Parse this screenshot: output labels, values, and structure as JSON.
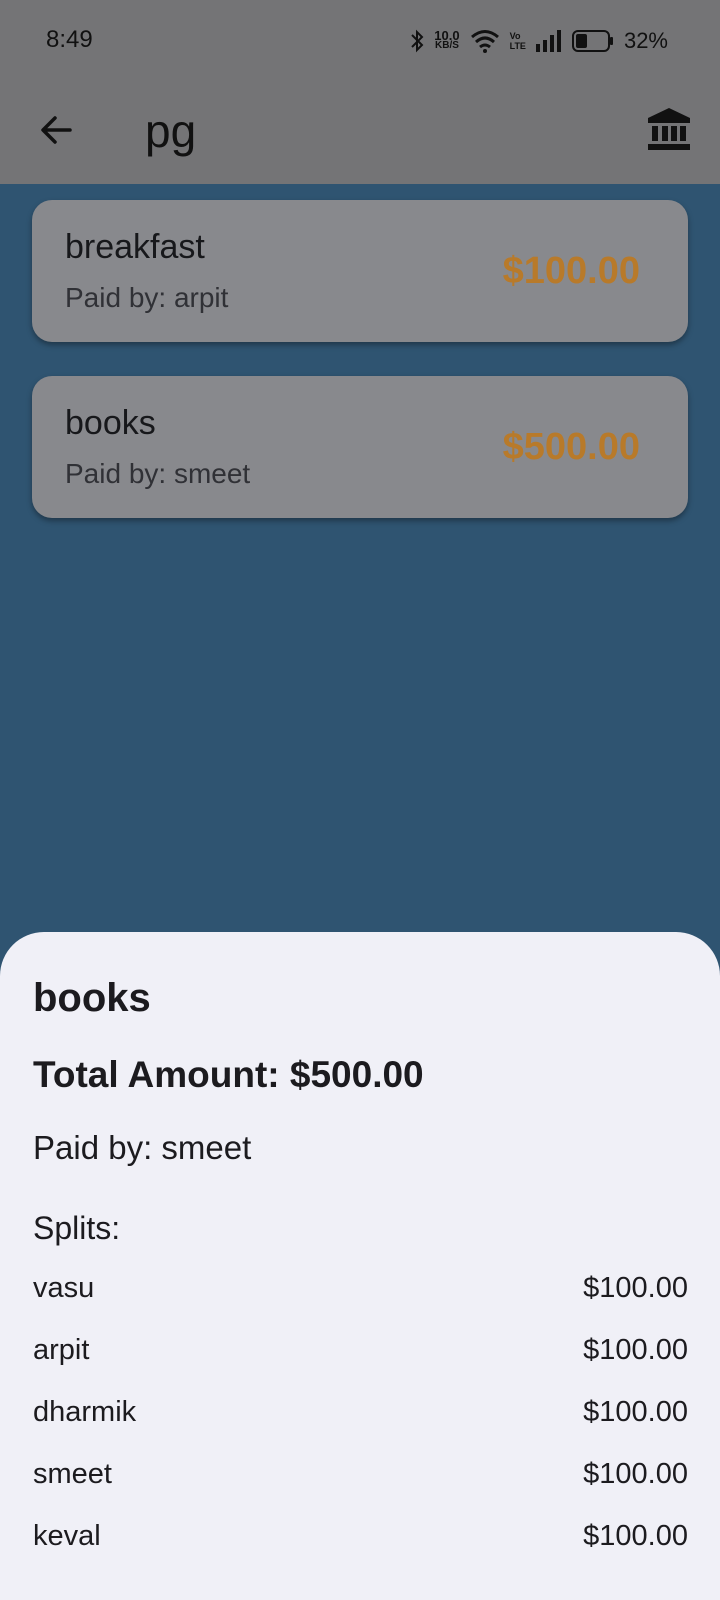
{
  "status_bar": {
    "time": "8:49",
    "net_speed_value": "10.0",
    "net_speed_unit": "KB/S",
    "volte_top": "Vo",
    "volte_bottom": "LTE",
    "battery_percent": "32%"
  },
  "app_bar": {
    "title": "pg",
    "back_icon": "arrow-left",
    "action_icon": "bank"
  },
  "expenses": [
    {
      "name": "breakfast",
      "paid_by": "Paid by: arpit",
      "amount": "$100.00"
    },
    {
      "name": "books",
      "paid_by": "Paid by: smeet",
      "amount": "$500.00"
    }
  ],
  "sheet": {
    "title": "books",
    "total": "Total Amount: $500.00",
    "paid_by": "Paid by: smeet",
    "splits_heading": "Splits:",
    "splits": [
      {
        "name": "vasu",
        "amount": "$100.00"
      },
      {
        "name": "arpit",
        "amount": "$100.00"
      },
      {
        "name": "dharmik",
        "amount": "$100.00"
      },
      {
        "name": "smeet",
        "amount": "$100.00"
      },
      {
        "name": "keval",
        "amount": "$100.00"
      }
    ]
  },
  "colors": {
    "background": "#2f5471",
    "bar": "#747476",
    "card": "#88898d",
    "amount_accent": "#b87a2a",
    "sheet": "#f0f0f7"
  }
}
